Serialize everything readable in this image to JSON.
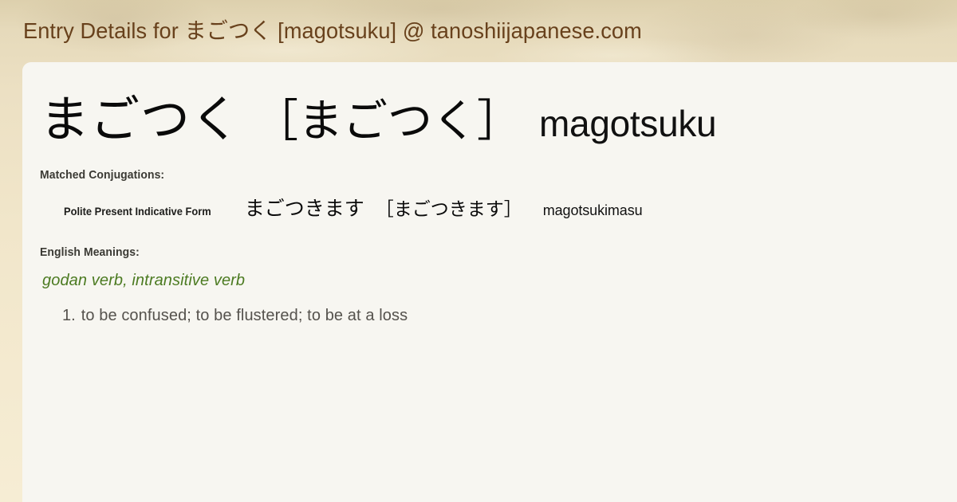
{
  "header": {
    "title_prefix": "Entry Details for ",
    "title_term": "まごつく",
    "title_suffix": " [magotsuku] @ tanoshiijapanese.com",
    "text_color": "#68411c",
    "background_color": "#ece0c3"
  },
  "entry": {
    "headword": "まごつく",
    "reading_bracketed": "［まごつく］",
    "romaji": "magotsuku"
  },
  "conjugations": {
    "heading": "Matched Conjugations:",
    "rows": [
      {
        "name": "Polite Present Indicative Form",
        "kana": "まごつきます",
        "reading_bracketed": "［まごつきます］",
        "romaji": "magotsukimasu"
      }
    ]
  },
  "meanings": {
    "heading": "English Meanings:",
    "parts_of_speech": "godan verb, intransitive verb",
    "parts_of_speech_color": "#4c7b22",
    "senses": [
      {
        "number": "1.",
        "text": "to be confused; to be flustered; to be at a loss"
      }
    ]
  },
  "panel": {
    "background_color": "#f7f6f1"
  }
}
